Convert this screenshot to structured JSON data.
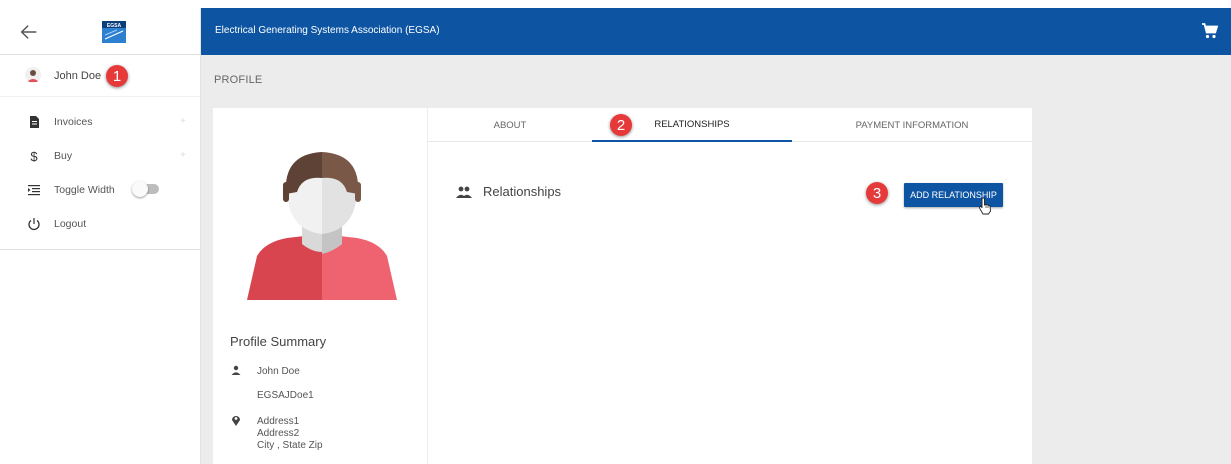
{
  "header": {
    "title": "Electrical Generating Systems Association (EGSA)",
    "background": "#0d55a3",
    "cart_icon": "cart-icon"
  },
  "sidebar": {
    "back_icon": "arrow-left-icon",
    "logo_text": "EGSA",
    "user": {
      "name": "John Doe",
      "icon": "avatar-icon"
    },
    "items": [
      {
        "label": "Invoices",
        "icon": "document-icon",
        "expand": "+"
      },
      {
        "label": "Buy",
        "icon": "dollar-icon",
        "expand": "+"
      },
      {
        "label": "Toggle Width",
        "icon": "indent-icon",
        "toggle_on": false
      },
      {
        "label": "Logout",
        "icon": "power-icon"
      }
    ]
  },
  "page": {
    "title": "PROFILE"
  },
  "tabs": [
    {
      "label": "ABOUT",
      "active": false
    },
    {
      "label": "RELATIONSHIPS",
      "active": true
    },
    {
      "label": "PAYMENT INFORMATION",
      "active": false
    }
  ],
  "relationships": {
    "title": "Relationships",
    "icon": "people-icon",
    "add_button": "ADD RELATIONSHIP"
  },
  "profile_summary": {
    "title": "Profile Summary",
    "name": "John Doe",
    "username": "EGSAJDoe1",
    "address1": "Address1",
    "address2": "Address2",
    "city_state_zip": "City , State Zip"
  },
  "badges": {
    "b1": "1",
    "b2": "2",
    "b3": "3"
  },
  "colors": {
    "accent": "#0d55a3",
    "badge": "#e63a3a",
    "avatar_shirt": "#e0515a",
    "avatar_hair": "#6b4d3e"
  }
}
